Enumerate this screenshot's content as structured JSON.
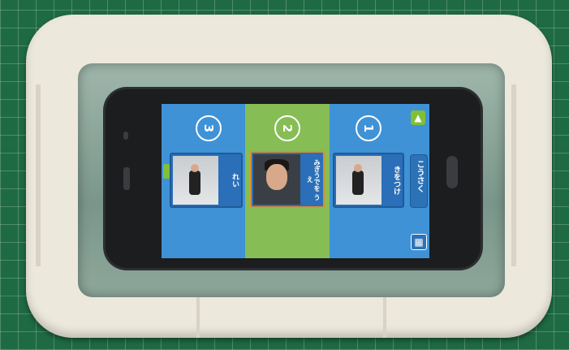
{
  "steps": [
    {
      "number": "3",
      "label": "れい",
      "state": "inactive"
    },
    {
      "number": "2",
      "label": "みぎうでを\nうえ",
      "state": "active"
    },
    {
      "number": "1",
      "label": "きをつけ",
      "state": "inactive"
    }
  ],
  "sidebar": {
    "top_icon": "up-arrow-icon",
    "middle_label": "こうさく",
    "bottom_icon": "gallery-icon"
  },
  "colors": {
    "mat_green": "#1e6a43",
    "case_white": "#ece8dc",
    "screen_blue": "#3f92d6",
    "screen_green": "#86bd55",
    "active_border": "#e38b2a"
  }
}
